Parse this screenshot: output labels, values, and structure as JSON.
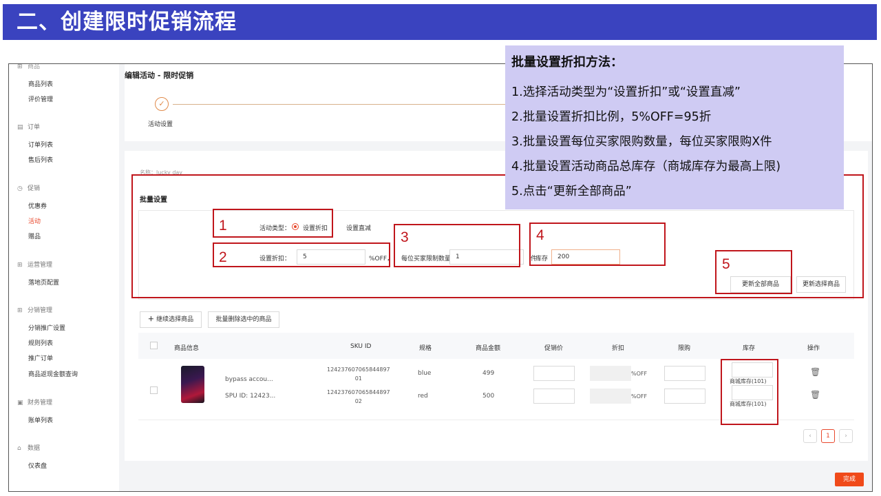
{
  "slide_title": "二、创建限时促销流程",
  "sidebar": {
    "cut_top": "商品",
    "items": [
      {
        "type": "item",
        "label": "商品列表"
      },
      {
        "type": "item",
        "label": "评价管理"
      },
      {
        "type": "group",
        "label": "订单",
        "icon": "▤"
      },
      {
        "type": "item",
        "label": "订单列表"
      },
      {
        "type": "item",
        "label": "售后列表"
      },
      {
        "type": "group",
        "label": "促销",
        "icon": "◷"
      },
      {
        "type": "item",
        "label": "优惠券"
      },
      {
        "type": "item",
        "label": "活动",
        "active": true
      },
      {
        "type": "item",
        "label": "赠品"
      },
      {
        "type": "group",
        "label": "运营管理",
        "icon": "⊞"
      },
      {
        "type": "item",
        "label": "落地页配置"
      },
      {
        "type": "group",
        "label": "分销管理",
        "icon": "⊞"
      },
      {
        "type": "item",
        "label": "分销推广设置"
      },
      {
        "type": "item",
        "label": "规则列表"
      },
      {
        "type": "item",
        "label": "推广订单"
      },
      {
        "type": "item",
        "label": "商品返现金额查询"
      },
      {
        "type": "group",
        "label": "财务管理",
        "icon": "▣"
      },
      {
        "type": "item",
        "label": "账单列表"
      },
      {
        "type": "group",
        "label": "数据",
        "icon": "⌂"
      },
      {
        "type": "item",
        "label": "仪表盘"
      }
    ]
  },
  "page": {
    "heading": "编辑活动 - 限时促销",
    "step1_label": "活动设置",
    "name_label_cut": "名称：lucky day"
  },
  "batch": {
    "heading": "批量设置",
    "activity_type_label": "活动类型：",
    "option_discount": "设置折扣",
    "option_direct": "设置直减",
    "set_discount_label": "设置折扣：",
    "discount_value": "5",
    "discount_suffix": "%OFF，",
    "limit_label": "每位买家限制数量",
    "limit_value": "1",
    "limit_suffix": "件",
    "stock_label": "库存",
    "stock_value": "200",
    "update_all_button": "更新全部商品",
    "update_selected_button": "更新选择商品"
  },
  "markers": [
    "1",
    "2",
    "3",
    "4",
    "5"
  ],
  "actions": {
    "continue_select": "继续选择商品",
    "batch_delete": "批量删除选中的商品"
  },
  "table": {
    "headers": [
      "商品信息",
      "SKU ID",
      "规格",
      "商品金额",
      "促销价",
      "折扣",
      "限购",
      "库存",
      "操作"
    ],
    "product_name": "bypass accou...",
    "spu": "SPU ID: 12423...",
    "rows": [
      {
        "sku": "124237607065844897\n01",
        "spec": "blue",
        "amount": "499",
        "discount_suffix": "%OFF",
        "stock": "商城库存(101)"
      },
      {
        "sku": "124237607065844897\n02",
        "spec": "red",
        "amount": "500",
        "discount_suffix": "%OFF",
        "stock": "商城库存(101)"
      }
    ]
  },
  "pagination": {
    "prev": "‹",
    "current": "1",
    "next": "›"
  },
  "finish_button": "完成",
  "callout": {
    "title": "批量设置折扣方法：",
    "lines": [
      "1.选择活动类型为“设置折扣”或“设置直减”",
      "2.批量设置折扣比例，5%OFF=95折",
      "3.批量设置每位买家限购数量，每位买家限购X件",
      "4.批量设置活动商品总库存（商城库存为最高上限)",
      "5.点击“更新全部商品”"
    ]
  },
  "colors": {
    "title_bar": "#3a43bf",
    "callout_bg": "#cfcbf3",
    "annotation_red": "#c0151b",
    "accent_orange": "#e8472b"
  }
}
